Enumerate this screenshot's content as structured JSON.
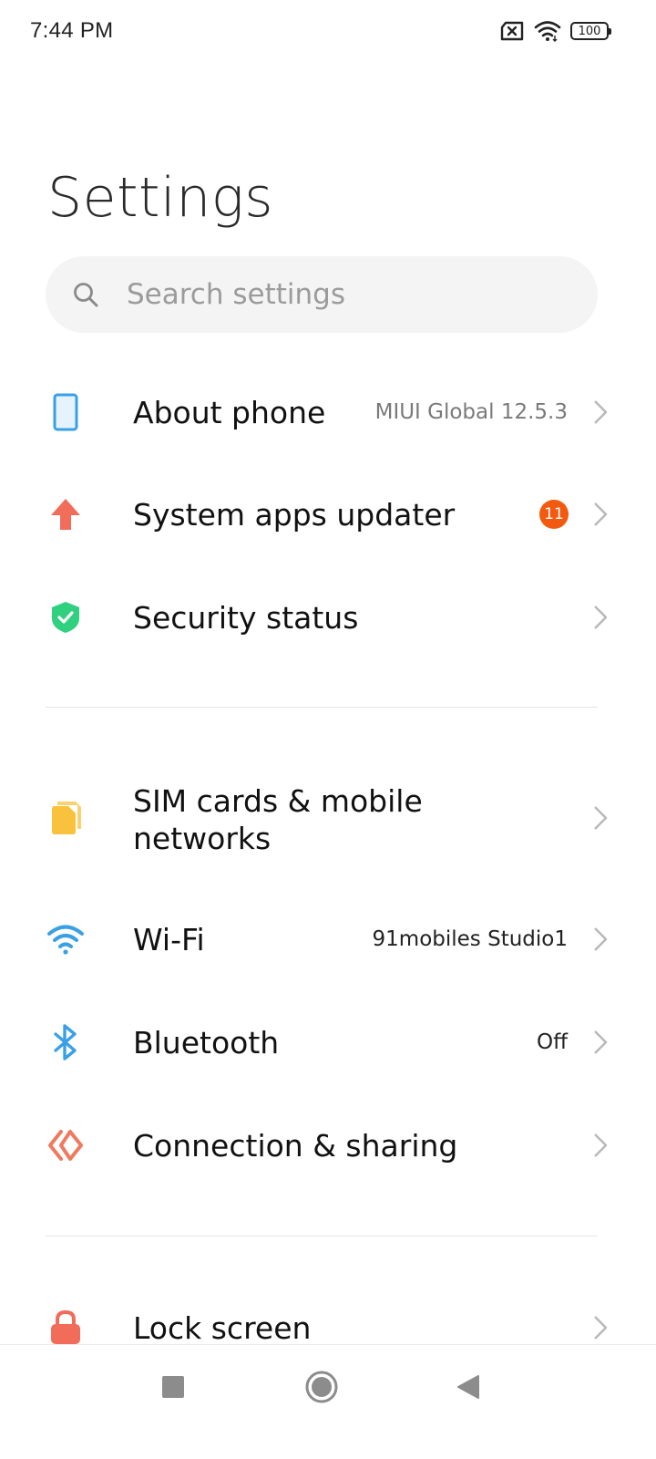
{
  "status_bar": {
    "time": "7:44 PM",
    "battery": "100",
    "icons": [
      "no-sim-icon",
      "wifi-icon",
      "battery-icon"
    ]
  },
  "page": {
    "title": "Settings"
  },
  "search": {
    "placeholder": "Search settings"
  },
  "colors": {
    "phone_blue": "#3aa0e6",
    "update_red": "#f26c5a",
    "security_green": "#2fd07e",
    "sim_yellow": "#f9c23c",
    "wifi_blue": "#3aa0e6",
    "bluetooth_blue": "#3aa0e6",
    "connection_orange": "#f07a5f",
    "lock_red": "#f26c5a",
    "badge_orange": "#f25a0f"
  },
  "items": [
    {
      "label": "About phone",
      "value": "MIUI Global 12.5.3",
      "icon": "phone-icon"
    },
    {
      "label": "System apps updater",
      "badge": "11",
      "icon": "upload-arrow-icon"
    },
    {
      "label": "Security status",
      "icon": "shield-check-icon"
    },
    {
      "label_line1": "SIM cards & mobile",
      "label_line2": "networks",
      "icon": "sim-card-icon"
    },
    {
      "label": "Wi-Fi",
      "value": "91mobiles Studio1",
      "icon": "wifi-icon"
    },
    {
      "label": "Bluetooth",
      "value": "Off",
      "icon": "bluetooth-icon"
    },
    {
      "label": "Connection & sharing",
      "icon": "connection-icon"
    },
    {
      "label": "Lock screen",
      "icon": "lock-icon"
    }
  ],
  "nav_bar": {
    "buttons": [
      "recents-button",
      "home-button",
      "back-button"
    ]
  }
}
